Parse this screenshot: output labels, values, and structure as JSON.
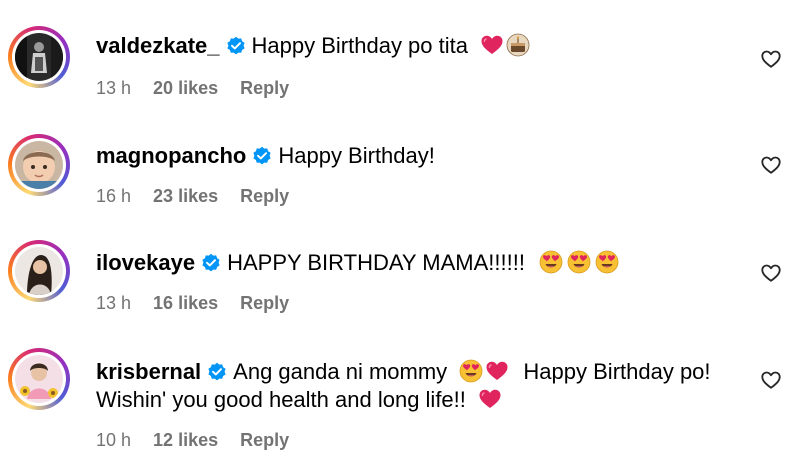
{
  "comments": [
    {
      "username": "valdezkate_",
      "text": "Happy Birthday po tita",
      "emojis": [
        "red-heart",
        "cake"
      ],
      "time": "13 h",
      "likes": "20 likes",
      "reply": "Reply"
    },
    {
      "username": "magnopancho",
      "text": "Happy Birthday!",
      "emojis": [],
      "time": "16 h",
      "likes": "23 likes",
      "reply": "Reply"
    },
    {
      "username": "ilovekaye",
      "text": "HAPPY BIRTHDAY MAMA!!!!!!",
      "emojis": [
        "heart-eyes",
        "heart-eyes",
        "heart-eyes"
      ],
      "time": "13 h",
      "likes": "16 likes",
      "reply": "Reply"
    },
    {
      "username": "krisbernal",
      "text": "Ang ganda ni mommy",
      "text_after": "Happy Birthday po!",
      "text_line2": "Wishin' you good health and long life!!",
      "emojis": [
        "heart-eyes",
        "red-heart"
      ],
      "emojis_line2": [
        "red-heart"
      ],
      "time": "10 h",
      "likes": "12 likes",
      "reply": "Reply"
    }
  ],
  "colors": {
    "verified": "#0095f6",
    "meta": "#737373",
    "heart_red": "#e0245e"
  },
  "icons": {
    "verified": "verified-badge-icon",
    "like": "heart-outline-icon"
  }
}
